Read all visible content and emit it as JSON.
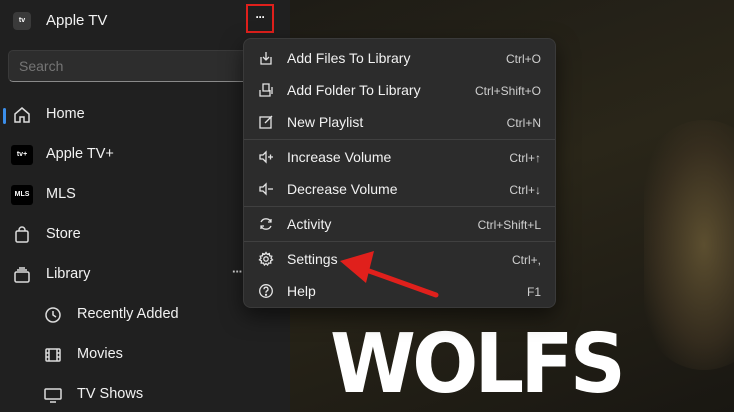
{
  "window": {
    "logo_text": "tv",
    "title": "Apple TV",
    "more_label": "···"
  },
  "sidebar": {
    "search_placeholder": "Search",
    "items": [
      {
        "label": "Home",
        "icon": "home-icon",
        "active": true
      },
      {
        "label": "Apple TV+",
        "icon": "apple-tv-plus-icon",
        "badge": "tv+"
      },
      {
        "label": "MLS",
        "icon": "mls-icon",
        "badge": "MLS"
      },
      {
        "label": "Store",
        "icon": "bag-icon"
      },
      {
        "label": "Library",
        "icon": "library-icon",
        "more_label": "···"
      },
      {
        "label": "Recently Added",
        "icon": "clock-icon"
      },
      {
        "label": "Movies",
        "icon": "film-icon"
      },
      {
        "label": "TV Shows",
        "icon": "tv-icon"
      }
    ]
  },
  "menu": {
    "items": [
      {
        "label": "Add Files To Library",
        "shortcut": "Ctrl+O",
        "icon": "add-file-icon"
      },
      {
        "label": "Add Folder To Library",
        "shortcut": "Ctrl+Shift+O",
        "icon": "add-folder-icon"
      },
      {
        "label": "New Playlist",
        "shortcut": "Ctrl+N",
        "icon": "edit-icon"
      },
      {
        "label": "Increase Volume",
        "shortcut": "Ctrl+↑",
        "icon": "volume-up-icon"
      },
      {
        "label": "Decrease Volume",
        "shortcut": "Ctrl+↓",
        "icon": "volume-down-icon"
      },
      {
        "label": "Activity",
        "shortcut": "Ctrl+Shift+L",
        "icon": "activity-icon"
      },
      {
        "label": "Settings",
        "shortcut": "Ctrl+,",
        "icon": "gear-icon"
      },
      {
        "label": "Help",
        "shortcut": "F1",
        "icon": "help-icon"
      }
    ]
  },
  "hero": {
    "title": "WOLFS"
  },
  "colors": {
    "accent": "#3b8eea",
    "highlight_red": "#e0201c",
    "menu_bg": "#2c2c2c",
    "sidebar_bg": "#202020"
  }
}
